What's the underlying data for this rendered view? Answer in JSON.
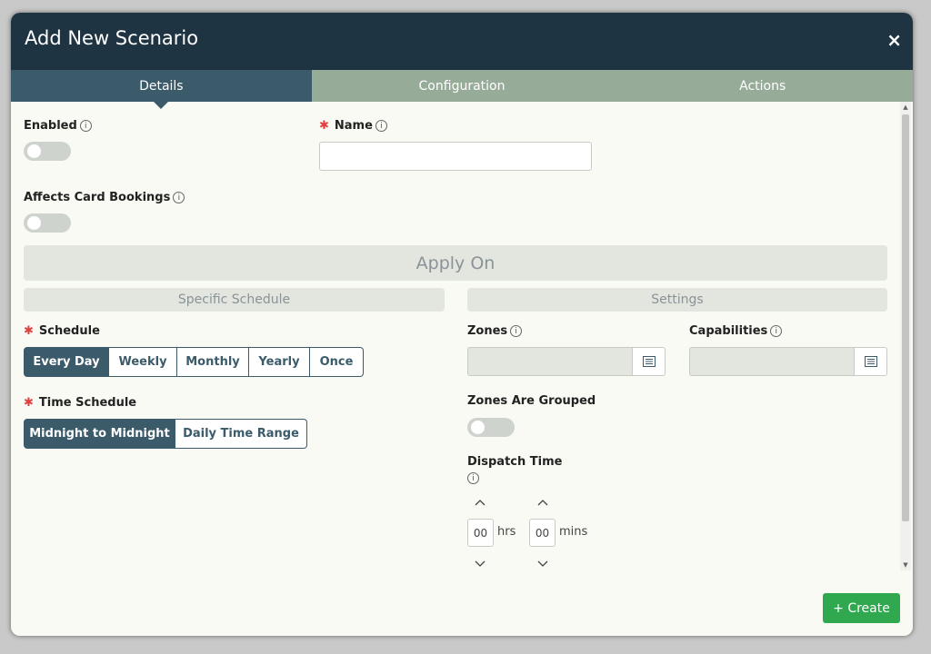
{
  "modal": {
    "title": "Add New Scenario",
    "close_icon": "×"
  },
  "tabs": [
    {
      "label": "Details",
      "active": true
    },
    {
      "label": "Configuration",
      "active": false
    },
    {
      "label": "Actions",
      "active": false
    }
  ],
  "details": {
    "enabled_label": "Enabled",
    "enabled_value": false,
    "name_label": "Name",
    "name_value": "",
    "affects_label": "Affects Card Bookings",
    "affects_value": false,
    "apply_on_title": "Apply On",
    "specific_schedule_title": "Specific Schedule",
    "settings_title": "Settings",
    "schedule_label": "Schedule",
    "schedule_options": [
      "Every Day",
      "Weekly",
      "Monthly",
      "Yearly",
      "Once"
    ],
    "schedule_selected": "Every Day",
    "time_schedule_label": "Time Schedule",
    "time_schedule_options": [
      "Midnight to Midnight",
      "Daily Time Range"
    ],
    "time_schedule_selected": "Midnight to Midnight",
    "zones_label": "Zones",
    "capabilities_label": "Capabilities",
    "zones_grouped_label": "Zones Are Grouped",
    "zones_grouped_value": false,
    "dispatch_time_label": "Dispatch Time",
    "dispatch_hours": "00",
    "dispatch_hours_unit": "hrs",
    "dispatch_mins": "00",
    "dispatch_mins_unit": "mins"
  },
  "footer": {
    "create_label": "+ Create"
  },
  "colors": {
    "header_bg": "#1f3443",
    "tab_active": "#3b5a6a",
    "tab_inactive": "#97ab99",
    "create_green": "#2fa84f",
    "required_red": "#e04040"
  },
  "icons": {
    "close": "close-icon",
    "info": "info-icon",
    "list": "list-icon",
    "chevron_up": "chevron-up-icon",
    "chevron_down": "chevron-down-icon"
  }
}
